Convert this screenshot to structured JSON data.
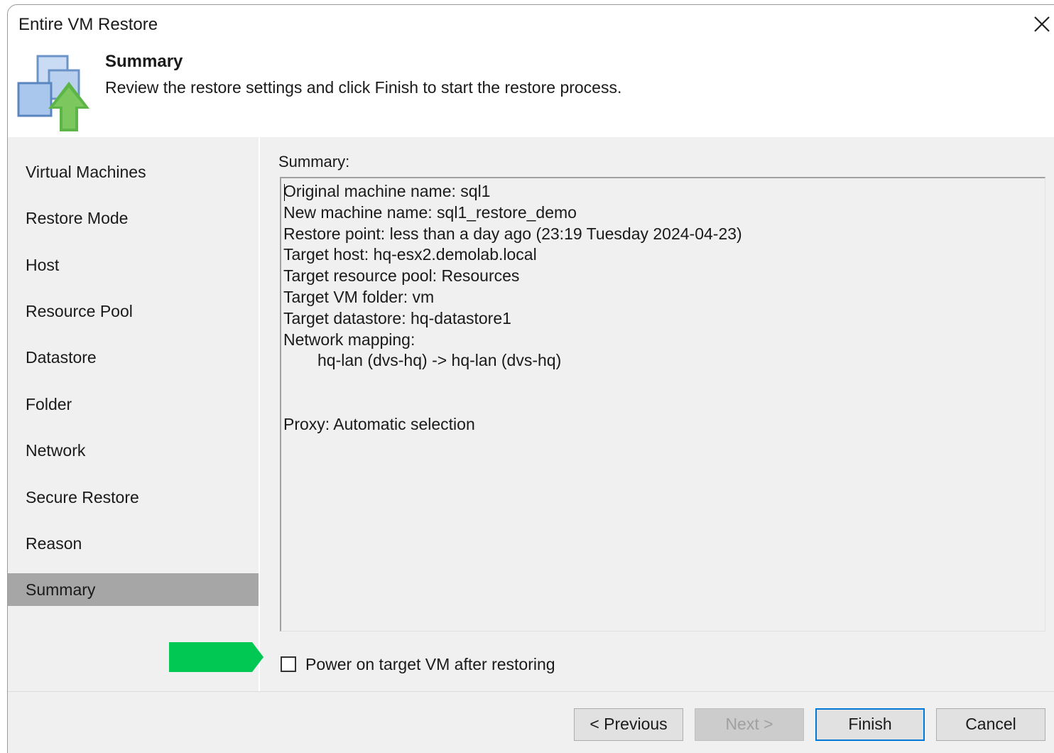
{
  "window": {
    "title": "Entire VM Restore"
  },
  "header": {
    "title": "Summary",
    "description": "Review the restore settings and click Finish to start the restore process.",
    "icon": "restore-vm-icon"
  },
  "steps": [
    {
      "label": "Virtual Machines"
    },
    {
      "label": "Restore Mode"
    },
    {
      "label": "Host"
    },
    {
      "label": "Resource Pool"
    },
    {
      "label": "Datastore"
    },
    {
      "label": "Folder"
    },
    {
      "label": "Network"
    },
    {
      "label": "Secure Restore"
    },
    {
      "label": "Reason"
    },
    {
      "label": "Summary",
      "active": true
    }
  ],
  "summary": {
    "label": "Summary:",
    "lines": {
      "original_machine": "Original machine name: sql1",
      "new_machine": "New machine name: sql1_restore_demo",
      "restore_point": "Restore point: less than a day ago (23:19 Tuesday 2024-04-23)",
      "target_host": "Target host: hq-esx2.demolab.local",
      "target_pool": "Target resource pool: Resources",
      "target_folder": "Target VM folder: vm",
      "target_datastore": "Target datastore: hq-datastore1",
      "network_mapping": "Network mapping:",
      "network_mapping_entry": "hq-lan (dvs-hq) -> hq-lan (dvs-hq)",
      "proxy": "Proxy: Automatic selection"
    }
  },
  "options": {
    "power_on_label": "Power on target VM after restoring",
    "power_on_checked": false
  },
  "buttons": {
    "previous": "< Previous",
    "next": "Next >",
    "finish": "Finish",
    "cancel": "Cancel"
  },
  "colors": {
    "accent": "#0078d7",
    "annotation_arrow": "#00c853",
    "active_step": "#a6a6a6",
    "panel": "#f0f0f0"
  }
}
